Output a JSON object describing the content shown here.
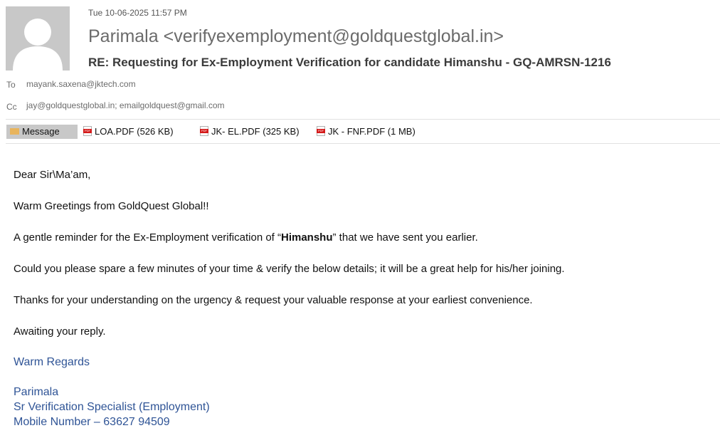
{
  "header": {
    "date": "Tue 10-06-2025 11:57 PM",
    "sender": "Parimala <verifyexemployment@goldquestglobal.in>",
    "subject": "RE: Requesting for Ex-Employment Verification for candidate Himanshu  - GQ-AMRSN-1216",
    "to_label": "To",
    "to_value": "mayank.saxena@jktech.com",
    "cc_label": "Cc",
    "cc_value": "jay@goldquestglobal.in; emailgoldquest@gmail.com"
  },
  "attachments_bar": {
    "message_tab": "Message",
    "attachments": [
      {
        "name": "LOA.PDF (526 KB)",
        "icon": "pdf-icon"
      },
      {
        "name": "JK- EL.PDF (325 KB)",
        "icon": "pdf-icon"
      },
      {
        "name": "JK - FNF.PDF (1 MB)",
        "icon": "pdf-icon"
      }
    ]
  },
  "body": {
    "greeting": "Dear Sir\\Ma’am,",
    "line1": "Warm Greetings from GoldQuest Global!!",
    "line2_pre": "A gentle reminder for the Ex-Employment verification of “",
    "line2_name": "Himanshu",
    "line2_post": "” that we have sent you earlier.",
    "line3": "Could you please spare a few minutes of your time & verify the below details; it will be a great  help for his/her joining.",
    "line4": "Thanks for your understanding on the urgency & request your valuable response at your earliest convenience.",
    "line5": "Awaiting your reply."
  },
  "signature": {
    "closing": "Warm Regards",
    "name": "Parimala",
    "title": "Sr Verification Specialist (Employment)",
    "mobile": "Mobile Number – 63627 94509"
  },
  "colors": {
    "signature_blue": "#2f5496",
    "tab_grey": "#c8c8c8",
    "pdf_red": "#d41a1a"
  }
}
